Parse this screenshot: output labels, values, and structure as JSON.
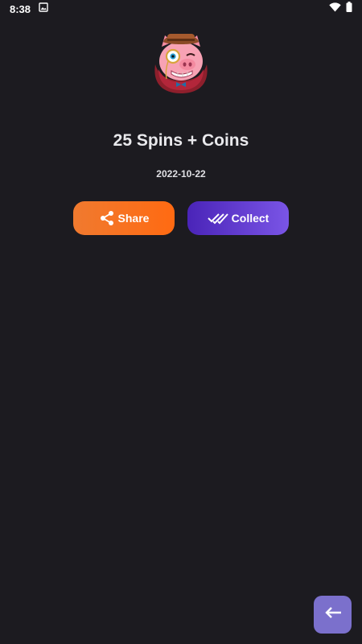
{
  "status_bar": {
    "time": "8:38",
    "icons": [
      "image-notification-icon",
      "wifi-icon",
      "battery-icon"
    ]
  },
  "mascot": {
    "icon": "pig-detective-mascot"
  },
  "reward": {
    "title": "25 Spins + Coins",
    "date": "2022-10-22"
  },
  "actions": {
    "share_label": "Share",
    "collect_label": "Collect"
  },
  "colors": {
    "background": "#1c1b20",
    "share_accent": "#ff6a12",
    "collect_accent": "#5a33d0",
    "back_button": "#7b70cc"
  },
  "fab": {
    "icon": "arrow-left-icon"
  }
}
